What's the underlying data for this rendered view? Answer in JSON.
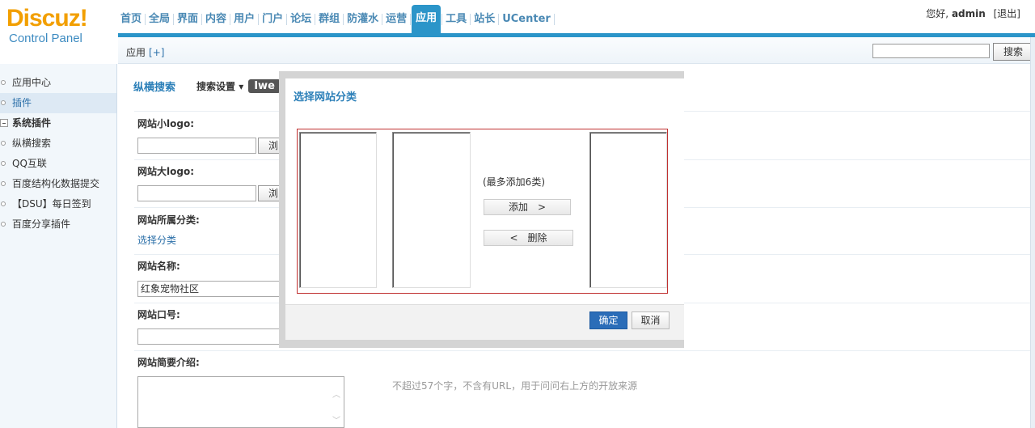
{
  "header": {
    "logo_main": "Discuz",
    "logo_bang": "!",
    "logo_sub": "Control Panel",
    "nav": [
      {
        "label": "首页",
        "active": false
      },
      {
        "label": "全局",
        "active": false
      },
      {
        "label": "界面",
        "active": false
      },
      {
        "label": "内容",
        "active": false
      },
      {
        "label": "用户",
        "active": false
      },
      {
        "label": "门户",
        "active": false
      },
      {
        "label": "论坛",
        "active": false
      },
      {
        "label": "群组",
        "active": false
      },
      {
        "label": "防灌水",
        "active": false
      },
      {
        "label": "运营",
        "active": false
      },
      {
        "label": "应用",
        "active": true
      },
      {
        "label": "工具",
        "active": false
      },
      {
        "label": "站长",
        "active": false
      },
      {
        "label": "UCenter",
        "active": false
      }
    ],
    "greeting": "您好,",
    "username": "admin",
    "logout": "[退出]"
  },
  "subbar": {
    "title": "应用",
    "add": "[+]",
    "search_value": "",
    "search_button": "搜索"
  },
  "sidebar": {
    "items": [
      {
        "label": "应用中心",
        "type": "item"
      },
      {
        "label": "插件",
        "type": "active"
      },
      {
        "label": "系统插件",
        "type": "group"
      },
      {
        "label": "纵横搜索",
        "type": "item"
      },
      {
        "label": "QQ互联",
        "type": "item"
      },
      {
        "label": "百度结构化数据提交",
        "type": "item"
      },
      {
        "label": "【DSU】每日签到",
        "type": "item"
      },
      {
        "label": "百度分享插件",
        "type": "item"
      }
    ]
  },
  "main": {
    "tab_title": "纵横搜索",
    "tab_menu": "搜索设置 ▾",
    "tab_dark": "Iwe",
    "small_logo_label": "网站小logo:",
    "small_logo_value": "",
    "browse": "浏",
    "big_logo_label": "网站大logo:",
    "big_logo_value": "",
    "category_label": "网站所属分类:",
    "choose_category": "选择分类",
    "site_name_label": "网站名称:",
    "site_name_value": "红象宠物社区",
    "slogan_label": "网站口号:",
    "slogan_value": "",
    "intro_label": "网站简要介绍:",
    "intro_value": "",
    "intro_hint": "不超过57个字，不含有URL，用于问问右上方的开放来源"
  },
  "dialog": {
    "title": "选择网站分类",
    "limit": "(最多添加6类)",
    "add_button": "添加　>",
    "remove_button": "<　删除",
    "ok": "确定",
    "cancel": "取消"
  }
}
